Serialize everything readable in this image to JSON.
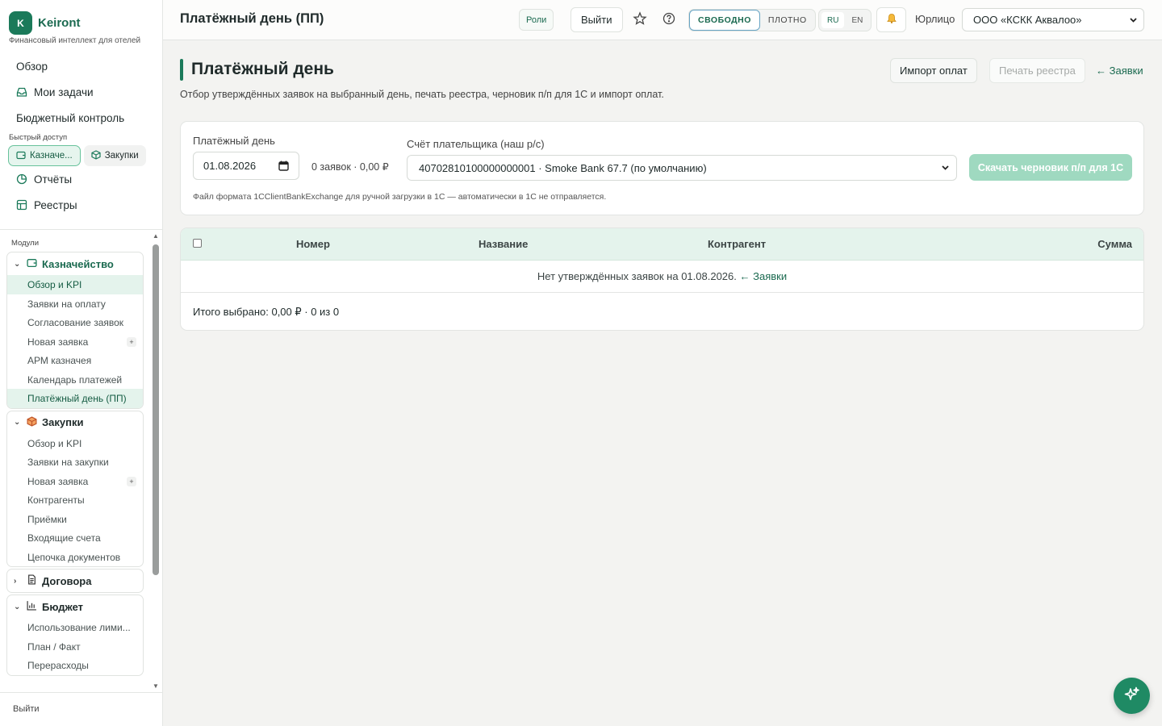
{
  "brand": {
    "logo_letter": "K",
    "name": "Keiront",
    "subtitle": "Финансовый интеллект для отелей"
  },
  "sidebar": {
    "top_items": [
      {
        "label": "Обзор",
        "icon": "none"
      },
      {
        "label": "Мои задачи",
        "icon": "inbox-icon"
      },
      {
        "label": "Бюджетный контроль",
        "icon": "none"
      }
    ],
    "quick_label": "Быстрый доступ",
    "quick_chips": [
      {
        "label": "Казначе...",
        "icon": "wallet-icon",
        "active": true
      },
      {
        "label": "Закупки",
        "icon": "box-icon",
        "active": false
      }
    ],
    "mid_items": [
      {
        "label": "Отчёты",
        "icon": "pie-icon"
      },
      {
        "label": "Реестры",
        "icon": "table-icon"
      }
    ],
    "modules_label": "Модули",
    "groups": [
      {
        "title": "Казначейство",
        "icon": "wallet-icon",
        "expanded": true,
        "items": [
          "Обзор и KPI",
          "Заявки на оплату",
          "Согласование заявок",
          "Новая заявка",
          "АРМ казначея",
          "Календарь платежей",
          "Платёжный день (ПП)"
        ]
      },
      {
        "title": "Закупки",
        "icon": "box-icon",
        "expanded": true,
        "items": [
          "Обзор и KPI",
          "Заявки на закупки",
          "Новая заявка",
          "Контрагенты",
          "Приёмки",
          "Входящие счета",
          "Цепочка документов"
        ]
      },
      {
        "title": "Договора",
        "icon": "doc-icon",
        "expanded": false,
        "items": []
      },
      {
        "title": "Бюджет",
        "icon": "bar-chart-icon",
        "expanded": true,
        "items": [
          "Использование лими...",
          "План / Факт",
          "Перерасходы"
        ]
      }
    ],
    "footer": "Выйти"
  },
  "topbar": {
    "title": "Платёжный день (ПП)",
    "roles": "Роли",
    "exit": "Выйти",
    "density": {
      "options": [
        "СВОБОДНО",
        "ПЛОТНО"
      ],
      "selected": "СВОБОДНО"
    },
    "lang": {
      "options": [
        "RU",
        "EN"
      ],
      "selected": "RU"
    },
    "entity_label": "Юрлицо",
    "entity_value": "ООО «КСКК Аквалоо»"
  },
  "page": {
    "title": "Платёжный день",
    "description": "Отбор утверждённых заявок на выбранный день, печать реестра, черновик п/п для 1С и импорт оплат.",
    "import_button": "Импорт оплат",
    "print_button": "Печать реестра",
    "back_link": "← Заявки"
  },
  "filter": {
    "date_label": "Платёжный день",
    "date_value": "01.08.2026",
    "summary": "0 заявок · 0,00 ₽",
    "account_label": "Счёт плательщика (наш р/с)",
    "account_value": "40702810100000000001 · Smoke Bank 67.7 (по умолчанию)",
    "download_button": "Скачать черновик п/п для 1С",
    "note": "Файл формата 1CClientBankExchange для ручной загрузки в 1С — автоматически в 1С не отправляется."
  },
  "table": {
    "columns": [
      "Номер",
      "Название",
      "Контрагент",
      "Сумма"
    ],
    "empty_text": "Нет утверждённых заявок на 01.08.2026.",
    "empty_link": "← Заявки",
    "total": "Итого выбрано: 0,00 ₽ · 0 из 0"
  },
  "colors": {
    "accent": "#1b7a5a",
    "accent_light": "#e4f3ec",
    "disabled_button": "#9fd9c0"
  }
}
